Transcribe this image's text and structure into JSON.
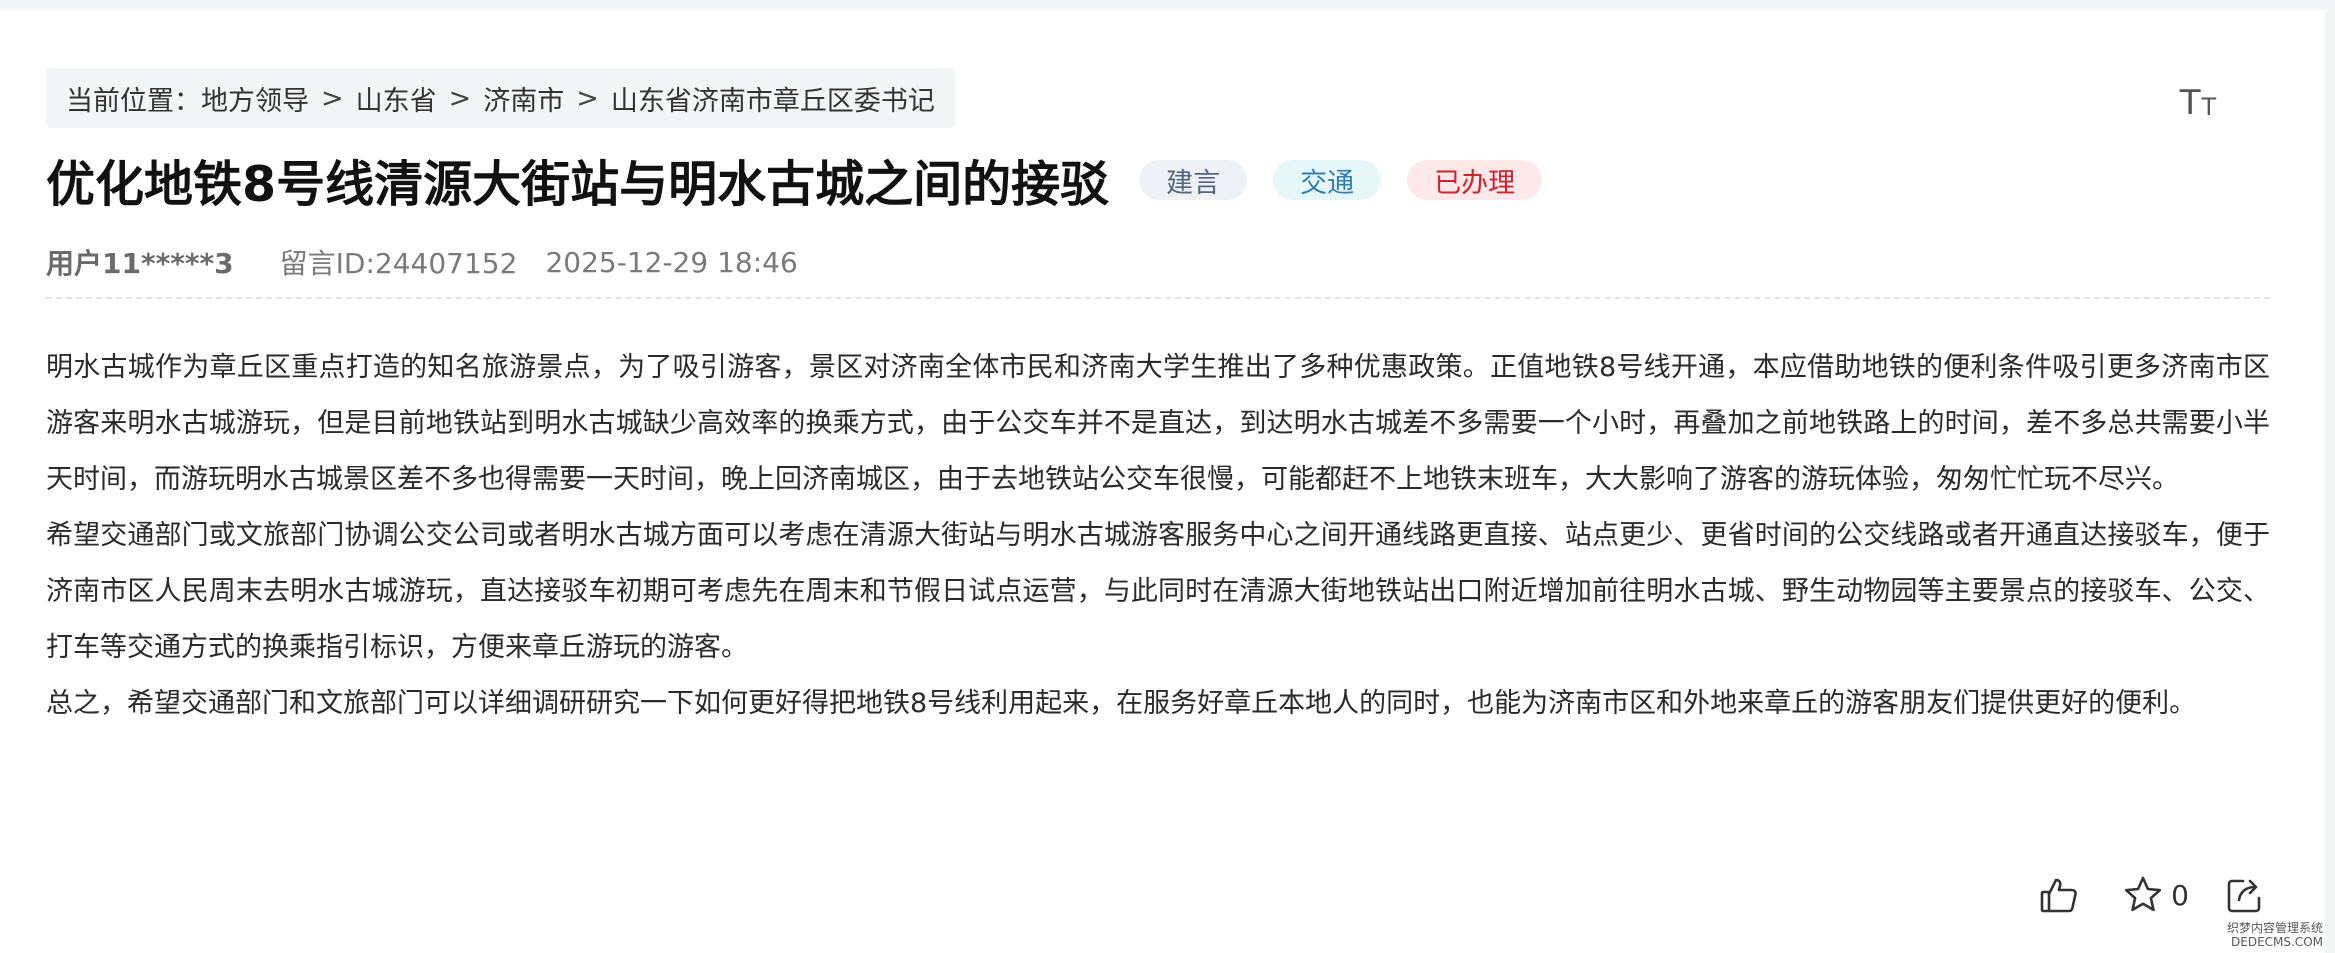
{
  "breadcrumb": {
    "prefix": "当前位置：",
    "items": [
      "地方领导",
      "山东省",
      "济南市",
      "山东省济南市章丘区委书记"
    ],
    "separator": ">"
  },
  "toolbar": {
    "font_size_big": "T",
    "font_size_small": "T"
  },
  "message": {
    "title": "优化地铁8号线清源大街站与明水古城之间的接驳",
    "tags": {
      "type": "建言",
      "category": "交通",
      "status": "已办理"
    },
    "user": "用户11*****3",
    "message_id": "留言ID:24407152",
    "time": "2025-12-29 18:46",
    "paragraphs": [
      "明水古城作为章丘区重点打造的知名旅游景点，为了吸引游客，景区对济南全体市民和济南大学生推出了多种优惠政策。正值地铁8号线开通，本应借助地铁的便利条件吸引更多济南市区游客来明水古城游玩，但是目前地铁站到明水古城缺少高效率的换乘方式，由于公交车并不是直达，到达明水古城差不多需要一个小时，再叠加之前地铁路上的时间，差不多总共需要小半天时间，而游玩明水古城景区差不多也得需要一天时间，晚上回济南城区，由于去地铁站公交车很慢，可能都赶不上地铁末班车，大大影响了游客的游玩体验，匆匆忙忙玩不尽兴。",
      "希望交通部门或文旅部门协调公交公司或者明水古城方面可以考虑在清源大街站与明水古城游客服务中心之间开通线路更直接、站点更少、更省时间的公交线路或者开通直达接驳车，便于济南市区人民周末去明水古城游玩，直达接驳车初期可考虑先在周末和节假日试点运营，与此同时在清源大街地铁站出口附近增加前往明水古城、野生动物园等主要景点的接驳车、公交、打车等交通方式的换乘指引标识，方便来章丘游玩的游客。",
      "总之，希望交通部门和文旅部门可以详细调研研究一下如何更好得把地铁8号线利用起来，在服务好章丘本地人的同时，也能为济南市区和外地来章丘的游客朋友们提供更好的便利。"
    ]
  },
  "actions": {
    "favorite_count": "0"
  },
  "watermark": {
    "line1": "织梦内容管理系统",
    "line2": "DEDECMS.COM"
  },
  "icons": {
    "font_size": "text-size-icon",
    "like": "thumbs-up-icon",
    "favorite": "star-icon",
    "share": "share-icon"
  },
  "colors": {
    "tag_type_bg": "#eef1f6",
    "tag_type_text": "#56657e",
    "tag_category_bg": "#e6f7fa",
    "tag_category_text": "#2f7fb4",
    "tag_status_bg": "#fde8ea",
    "tag_status_text": "#d1222f"
  }
}
